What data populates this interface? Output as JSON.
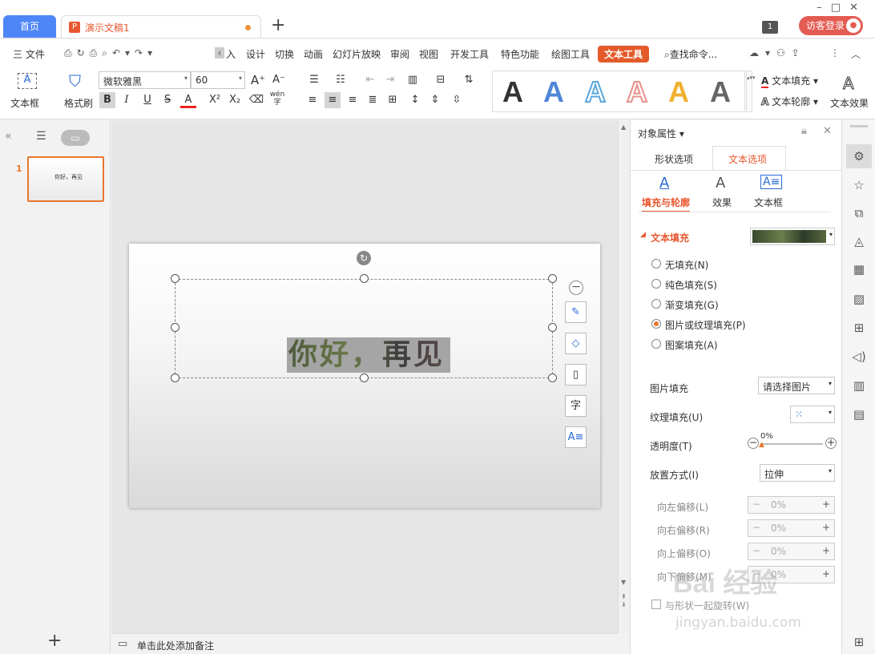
{
  "titlebar": {
    "home_tab": "首页",
    "doc_tab": "演示文稿1",
    "doc_icon": "P",
    "add_tab": "+",
    "window_count": "1",
    "login": "访客登录"
  },
  "menu": {
    "items": [
      "三 文件",
      "入",
      "设计",
      "切换",
      "动画",
      "幻灯片放映",
      "审阅",
      "视图",
      "开发工具",
      "特色功能",
      "绘图工具",
      "文本工具"
    ],
    "active": "文本工具",
    "search": "查找命令..."
  },
  "ribbon": {
    "textbox_label": "文本框",
    "format_painter": "格式刷",
    "font_name": "微软雅黑",
    "font_size": "60",
    "text_fill": "文本填充",
    "text_outline": "文本轮廓",
    "text_effect": "文本效果",
    "art_letters": [
      "A",
      "A",
      "A",
      "A",
      "A",
      "A"
    ],
    "art_colors": [
      "#111111",
      "#4f86d8",
      "#5aa6dc",
      "#e8918a",
      "#f0b030",
      "#666666"
    ],
    "pinyin": "wén"
  },
  "slides": {
    "number": "1",
    "thumb_text": "你好，再见"
  },
  "slide": {
    "text": "你好，再见"
  },
  "notes": {
    "placeholder": "单击此处添加备注"
  },
  "panel": {
    "title": "对象属性",
    "tabs": [
      "形状选项",
      "文本选项"
    ],
    "active_tab": "文本选项",
    "subtabs": [
      "填充与轮廓",
      "效果",
      "文本框"
    ],
    "section": "文本填充",
    "fill_options": [
      "无填充(N)",
      "纯色填充(S)",
      "渐变填充(G)",
      "图片或纹理填充(P)",
      "图案填充(A)"
    ],
    "selected_fill": "图片或纹理填充(P)",
    "picture_fill_label": "图片填充",
    "picture_fill_value": "请选择图片",
    "texture_fill_label": "纹理填充(U)",
    "transparency_label": "透明度(T)",
    "transparency_value": "0%",
    "placement_label": "放置方式(I)",
    "placement_value": "拉伸",
    "offsets": [
      {
        "label": "向左偏移(L)",
        "value": "0%"
      },
      {
        "label": "向右偏移(R)",
        "value": "0%"
      },
      {
        "label": "向上偏移(O)",
        "value": "0%"
      },
      {
        "label": "向下偏移(M)",
        "value": "0%"
      }
    ],
    "tile_with_shape": "与形状一起旋转(W)"
  },
  "watermark": {
    "main": "Bai 经验",
    "sub": "jingyan.baidu.com"
  }
}
